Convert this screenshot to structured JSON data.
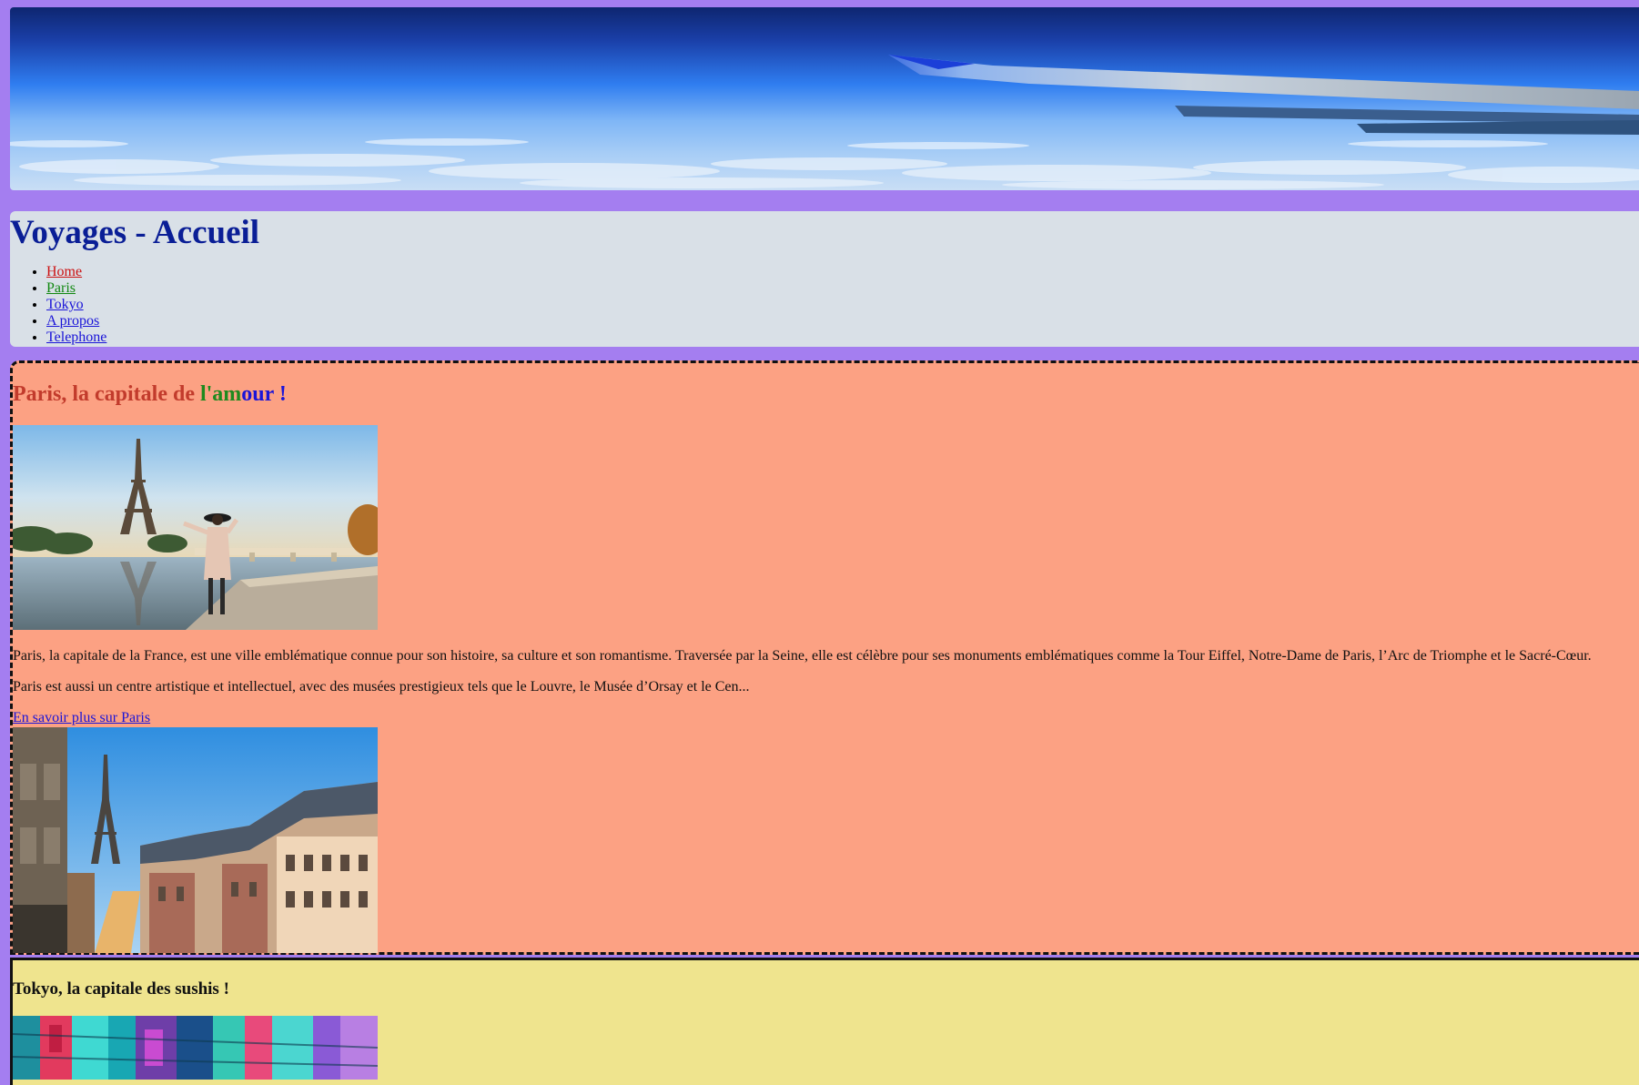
{
  "banner": {
    "alt": "Airplane wing above clouds"
  },
  "header": {
    "title": "Voyages - Accueil",
    "nav": [
      {
        "label": "Home",
        "color": "#cc1111"
      },
      {
        "label": "Paris",
        "color": "#118811"
      },
      {
        "label": "Tokyo",
        "color": "#1a14d8"
      },
      {
        "label": "A propos",
        "color": "#1a14d8"
      },
      {
        "label": "Telephone",
        "color": "#1a14d8"
      }
    ]
  },
  "paris": {
    "heading_part1": "Paris, la capitale de ",
    "heading_part2": "l'am",
    "heading_part3": "our !",
    "heading_colors": [
      "#c23b2c",
      "#1e8a1e",
      "#1a14d8"
    ],
    "paragraph1": "Paris, la capitale de la France, est une ville emblématique connue pour son histoire, sa culture et son romantisme. Traversée par la Seine, elle est célèbre pour ses monuments emblématiques comme la Tour Eiffel, Notre-Dame de Paris, l’Arc de Triomphe et le Sacré-Cœur.",
    "paragraph2": "Paris est aussi un centre artistique et intellectuel, avec des musées prestigieux tels que le Louvre, le Musée d’Orsay et le Cen...",
    "link_label": "En savoir plus sur Paris"
  },
  "tokyo": {
    "heading": "Tokyo, la capitale des sushis !"
  },
  "colors": {
    "page_background": "#a47ef0",
    "header_background": "#d9e0e7",
    "paris_background": "#fca183",
    "tokyo_background": "#efe48e",
    "title_color": "#0a1e96"
  }
}
